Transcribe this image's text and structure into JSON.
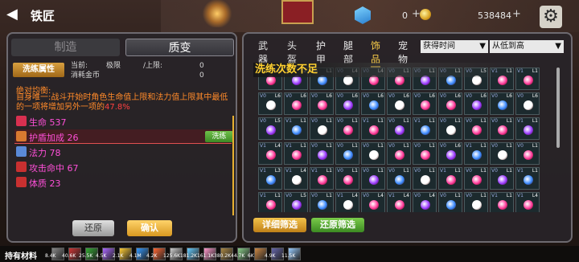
{
  "header": {
    "title": "铁匠",
    "gem_value": "0",
    "coin_value": "538484",
    "plus": "+"
  },
  "left": {
    "tabs": [
      "制造",
      "质变"
    ],
    "wash_tag": "洗练属性",
    "info": {
      "current_label": "当前:",
      "cost_label": "消耗金币",
      "limit_label": "极限",
      "upper_label": "/上限:",
      "limit_val1": "0",
      "limit_val2": "0"
    },
    "desc_title": "绝对均衡:",
    "desc_text": "自身唯一:战斗开始时角色生命值上限和法力值上限其中最低的一项将增加另外一项的",
    "desc_pct": "47.8%",
    "attributes": [
      {
        "label": "生命 537",
        "color": "#d83050"
      },
      {
        "label": "护盾加成 26",
        "color": "#d87a30"
      },
      {
        "label": "法力 78",
        "color": "#5a8ad8"
      },
      {
        "label": "攻击命中 67",
        "color": "#c83030"
      },
      {
        "label": "体质 23",
        "color": "#c83030"
      }
    ],
    "wash_button": "洗练",
    "restore_button": "还原",
    "confirm_button": "确认"
  },
  "right": {
    "tabs": [
      "武器",
      "头盔",
      "护甲",
      "腿部",
      "饰品",
      "宠物"
    ],
    "active_tab": "饰品",
    "sort_by": "获得时间",
    "sort_order": "从低到高",
    "warning": "洗练次数不足",
    "detail_filter": "详细筛选",
    "reset_filter": "还原筛选",
    "grid_labels": {
      "rows": [
        [
          "V0",
          "V1",
          "V0",
          "V0",
          "V0",
          "V0",
          "V0",
          "V0",
          "V0",
          "V1",
          "V1"
        ],
        [
          "V0",
          "V0",
          "V0",
          "V0",
          "V0",
          "V0",
          "V0",
          "V0",
          "V0",
          "V0",
          "V0"
        ],
        [
          "V0",
          "V1",
          "V0",
          "V0",
          "V1",
          "V0",
          "V1",
          "V0",
          "V0",
          "V0",
          "V1"
        ],
        [
          "V1",
          "V1",
          "V0",
          "V0",
          "V0",
          "V0",
          "V0",
          "V0",
          "V1",
          "V0",
          "V0"
        ],
        [
          "V1",
          "V1",
          "V1",
          "V0",
          "V0",
          "V0",
          "V0",
          "V1",
          "V0",
          "V0",
          "V1"
        ],
        [
          "V1",
          "V0",
          "V0",
          "V1",
          "V0",
          "V1",
          "V0",
          "V0",
          "V0",
          "V1",
          "V1"
        ]
      ],
      "right_rows": [
        [
          "L4",
          "L1",
          "L1",
          "L4",
          "L4",
          "L1",
          "L1",
          "L1",
          "L5",
          "L1",
          "L1"
        ],
        [
          "L6",
          "L6",
          "L6",
          "L6",
          "L6",
          "L6",
          "L6",
          "L6",
          "L6",
          "L6",
          "L6"
        ],
        [
          "L5",
          "L1",
          "L1",
          "L1",
          "L1",
          "L1",
          "L1",
          "L1",
          "L1",
          "L1",
          "L1"
        ],
        [
          "L4",
          "L1",
          "L1",
          "L1",
          "L1",
          "L1",
          "L1",
          "L6",
          "L1",
          "L1",
          "L1"
        ],
        [
          "L3",
          "L4",
          "L1",
          "L1",
          "L1",
          "L1",
          "L1",
          "L1",
          "L1",
          "L1",
          "L1"
        ],
        [
          "L1",
          "L5",
          "L1",
          "L4",
          "L4",
          "L4",
          "L4",
          "L1",
          "L1",
          "L1",
          "L4"
        ]
      ]
    }
  },
  "bottom": {
    "label": "持有材料",
    "materials": [
      "8.4K",
      "40.6K",
      "25.5K",
      "4.5K",
      "2.1K",
      "4.1M",
      "4.2K",
      "125.6K",
      "181.2K",
      "161.1K",
      "380.2K",
      "44.7K",
      "6K",
      "4.9K",
      "11.5K"
    ]
  }
}
